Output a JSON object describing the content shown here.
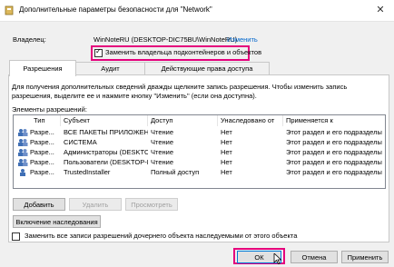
{
  "window": {
    "title": "Дополнительные параметры безопасности  для \"Network\"",
    "close_glyph": "✕"
  },
  "owner": {
    "label": "Владелец:",
    "value": "WinNoteRU (DESKTOP-DIC75BU\\WinNoteRU)",
    "change_link": "Изменить"
  },
  "replace_owner_checkbox": {
    "label": "Заменить владельца подконтейнеров и объектов",
    "checked": true
  },
  "tabs": [
    {
      "label": "Разрешения",
      "active": true
    },
    {
      "label": "Аудит",
      "active": false
    },
    {
      "label": "Действующие права доступа",
      "active": false
    }
  ],
  "info_text": "Для получения дополнительных сведений дважды щелкните запись разрешения. Чтобы изменить запись разрешения, выделите ее и нажмите кнопку \"Изменить\" (если она доступна).",
  "permissions_label": "Элементы разрешений:",
  "table": {
    "columns": [
      "Тип",
      "Субъект",
      "Доступ",
      "Унаследовано от",
      "Применяется к"
    ],
    "rows": [
      {
        "type": "Разре...",
        "subject": "ВСЕ ПАКЕТЫ ПРИЛОЖЕНИЙ",
        "access": "Чтение",
        "inherited": "Нет",
        "applies": "Этот раздел и его подразделы"
      },
      {
        "type": "Разре...",
        "subject": "СИСТЕМА",
        "access": "Чтение",
        "inherited": "Нет",
        "applies": "Этот раздел и его подразделы"
      },
      {
        "type": "Разре...",
        "subject": "Администраторы (DESKTOP-...",
        "access": "Чтение",
        "inherited": "Нет",
        "applies": "Этот раздел и его подразделы"
      },
      {
        "type": "Разре...",
        "subject": "Пользователи (DESKTOP-DI...",
        "access": "Чтение",
        "inherited": "Нет",
        "applies": "Этот раздел и его подразделы"
      },
      {
        "type": "Разре...",
        "subject": "TrustedInstaller",
        "access": "Полный доступ",
        "inherited": "Нет",
        "applies": "Этот раздел и его подразделы"
      }
    ]
  },
  "buttons": {
    "add": "Добавить",
    "remove": "Удалить",
    "view": "Просмотреть",
    "enable_inheritance": "Включение наследования",
    "ok": "ОК",
    "cancel": "Отмена",
    "apply": "Применить"
  },
  "replace_child_checkbox": {
    "label": "Заменить все записи разрешений дочернего объекта наследуемыми от этого объекта",
    "checked": false
  },
  "colors": {
    "highlight": "#e4007c",
    "link": "#0066cc"
  }
}
